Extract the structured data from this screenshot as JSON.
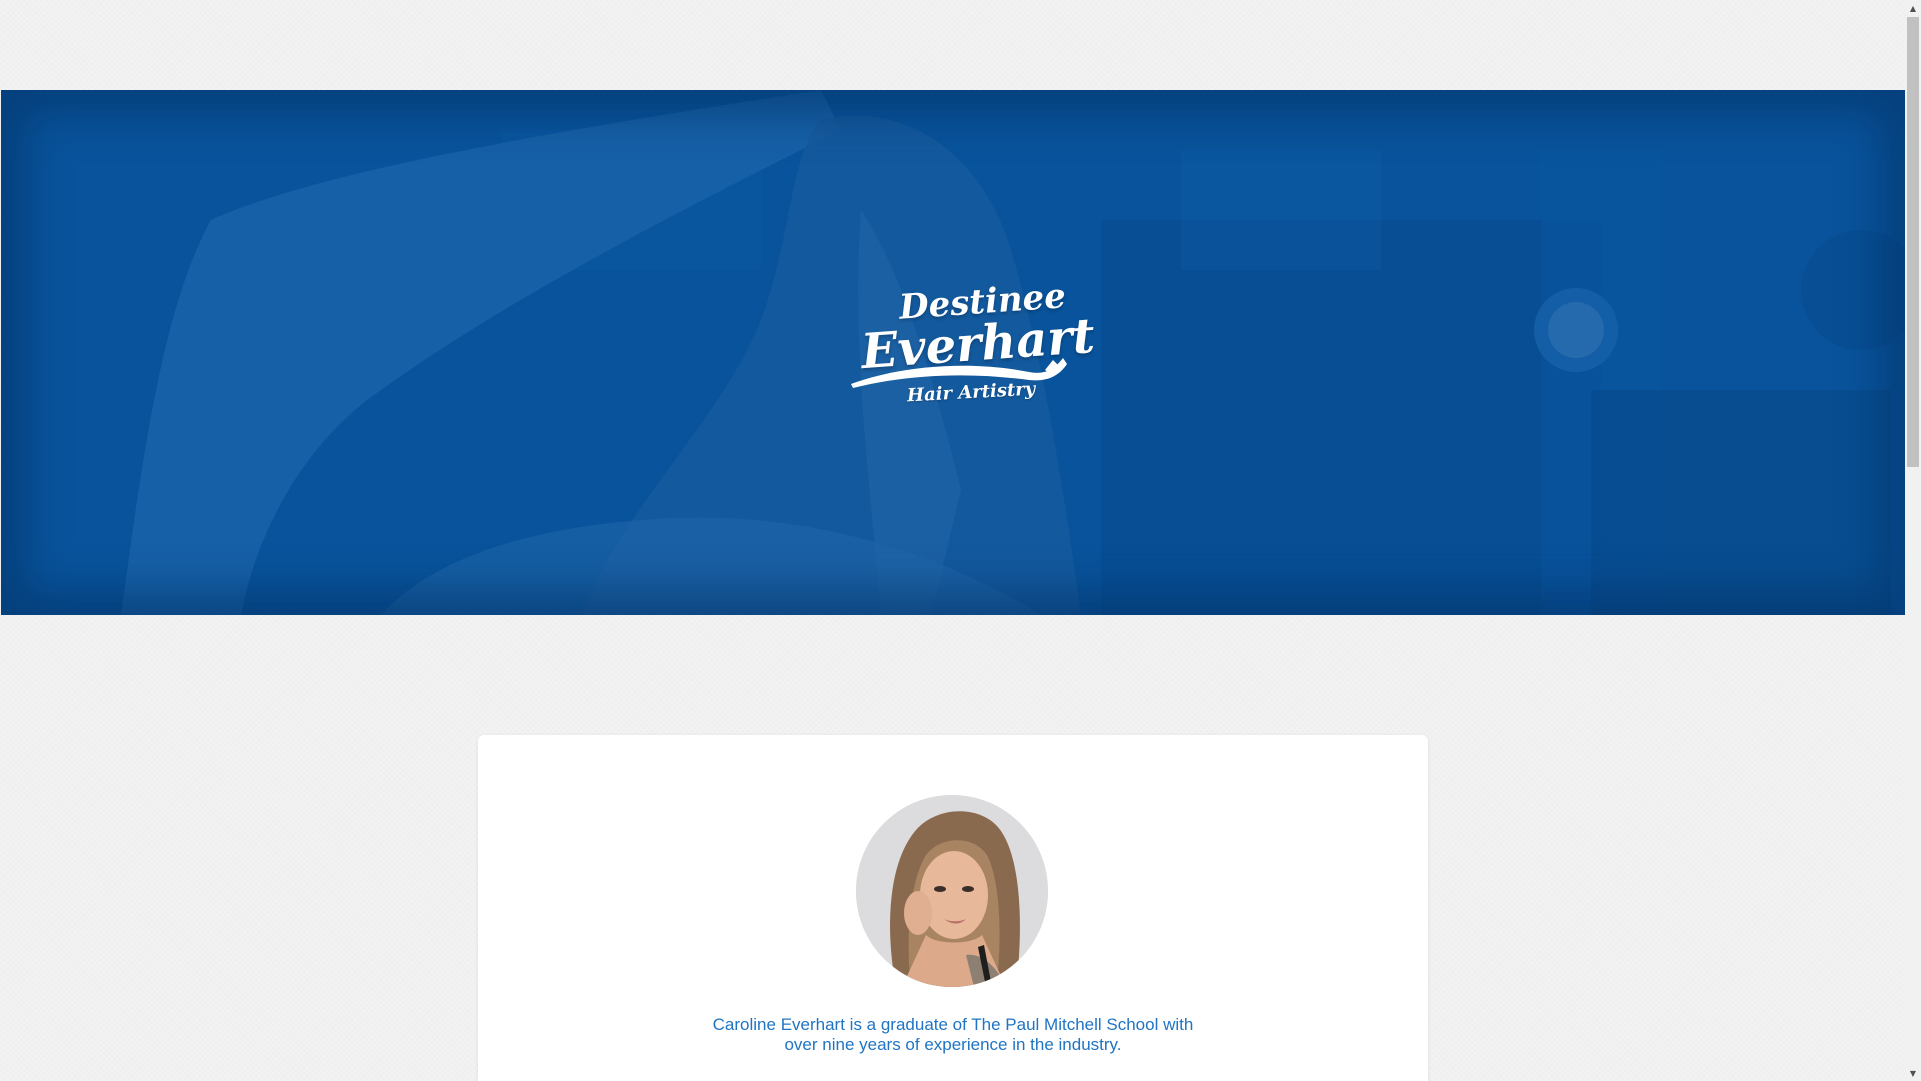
{
  "hero": {
    "logo": {
      "line1": "Destinee",
      "line2": "Everhart",
      "line3": "Hair Artistry"
    },
    "overlay_color": "#0a4f94"
  },
  "about": {
    "bio_line1": "Caroline Everhart is a graduate of The Paul Mitchell School with",
    "bio_line2": "over nine years of experience in the industry.",
    "text_color": "#1f74c4"
  },
  "scrollbar": {
    "up_icon": "triangle-up",
    "down_icon": "triangle-down"
  }
}
